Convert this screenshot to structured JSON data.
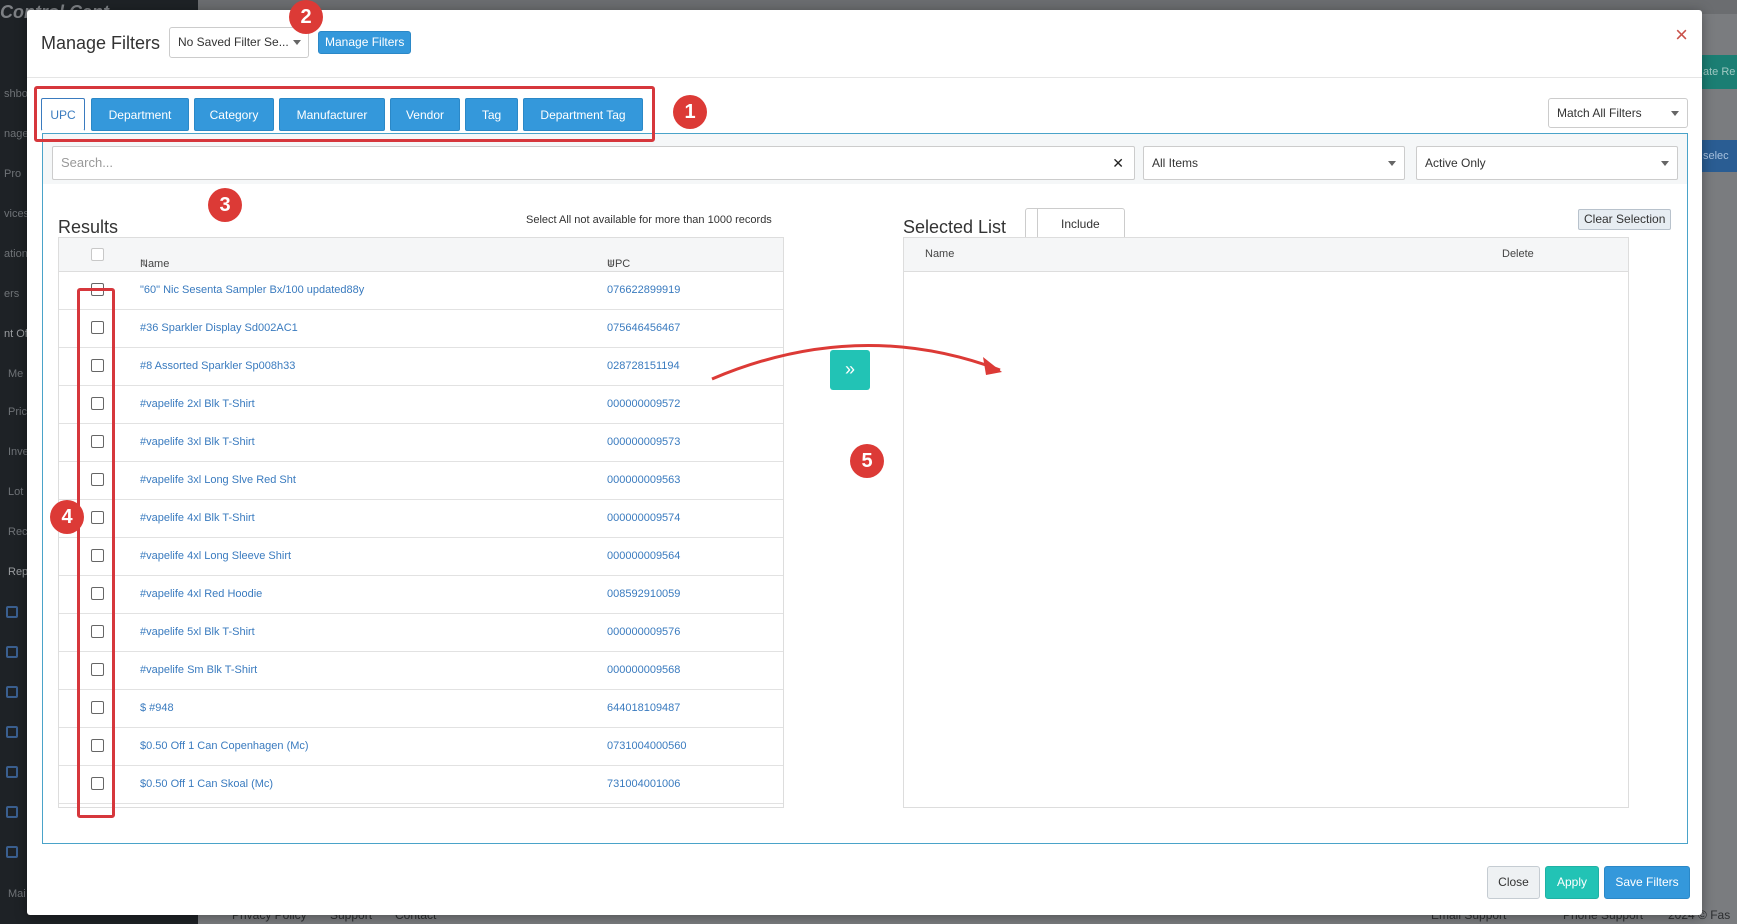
{
  "background": {
    "logo": "Control Cent",
    "sidebar_items": [
      "shboa",
      "nage",
      "Pro",
      "vices",
      "ation",
      "ers",
      "nt Of",
      "Me",
      "Pric",
      "Inve",
      "Lot",
      "Rec",
      "Rep",
      "Mai"
    ],
    "teal_button": "ate Re",
    "blue_button": "selec",
    "footer_links": [
      "Privacy Policy",
      "Support",
      "Contact"
    ],
    "footer_right": [
      "Email Support",
      "Phone Support",
      "2024 © Fas"
    ]
  },
  "modal": {
    "title": "Manage Filters",
    "saved_filter_value": "No Saved Filter Se...",
    "manage_filters_button": "Manage Filters",
    "close_icon": "×",
    "tabs": [
      {
        "label": "UPC",
        "active": true
      },
      {
        "label": "Department"
      },
      {
        "label": "Category"
      },
      {
        "label": "Manufacturer"
      },
      {
        "label": "Vendor"
      },
      {
        "label": "Tag"
      },
      {
        "label": "Department Tag"
      }
    ],
    "match_select_value": "Match All Filters",
    "search": {
      "placeholder": "Search...",
      "clear_icon": "✕"
    },
    "items_select_value": "All Items",
    "status_select_value": "Active Only",
    "results": {
      "title": "Results",
      "note": "Select All not available for more than 1000 records",
      "columns": {
        "name": "Name",
        "upc": "UPC"
      },
      "rows": [
        {
          "name": "\"60\" Nic Sesenta Sampler Bx/100 updated88y",
          "upc": "076622899919"
        },
        {
          "name": "#36 Sparkler Display Sd002AC1",
          "upc": "075646456467"
        },
        {
          "name": "#8 Assorted Sparkler Sp008h33",
          "upc": "028728151194"
        },
        {
          "name": "#vapelife 2xl Blk T-Shirt",
          "upc": "000000009572"
        },
        {
          "name": "#vapelife 3xl Blk T-Shirt",
          "upc": "000000009573"
        },
        {
          "name": "#vapelife 3xl Long Slve Red Sht",
          "upc": "000000009563"
        },
        {
          "name": "#vapelife 4xl Blk T-Shirt",
          "upc": "000000009574"
        },
        {
          "name": "#vapelife 4xl Long Sleeve Shirt",
          "upc": "000000009564"
        },
        {
          "name": "#vapelife 4xl Red Hoodie",
          "upc": "008592910059"
        },
        {
          "name": "#vapelife 5xl Blk T-Shirt",
          "upc": "000000009576"
        },
        {
          "name": "#vapelife Sm Blk T-Shirt",
          "upc": "000000009568"
        },
        {
          "name": "$ #948",
          "upc": "644018109487"
        },
        {
          "name": "$0.50 Off 1 Can Copenhagen (Mc)",
          "upc": "0731004000560"
        },
        {
          "name": "$0.50 Off 1 Can Skoal (Mc)",
          "upc": "731004001006"
        }
      ]
    },
    "move_icon": "»",
    "selected": {
      "title": "Selected List",
      "include_label": "Include",
      "clear_button": "Clear Selection",
      "columns": {
        "name": "Name",
        "delete": "Delete"
      }
    },
    "footer": {
      "close": "Close",
      "apply": "Apply",
      "save": "Save Filters"
    }
  },
  "annotations": [
    "1",
    "2",
    "3",
    "4",
    "5"
  ],
  "colors": {
    "primary": "#3498db",
    "teal": "#22c3b5",
    "annotation_red": "#dc3a36"
  }
}
